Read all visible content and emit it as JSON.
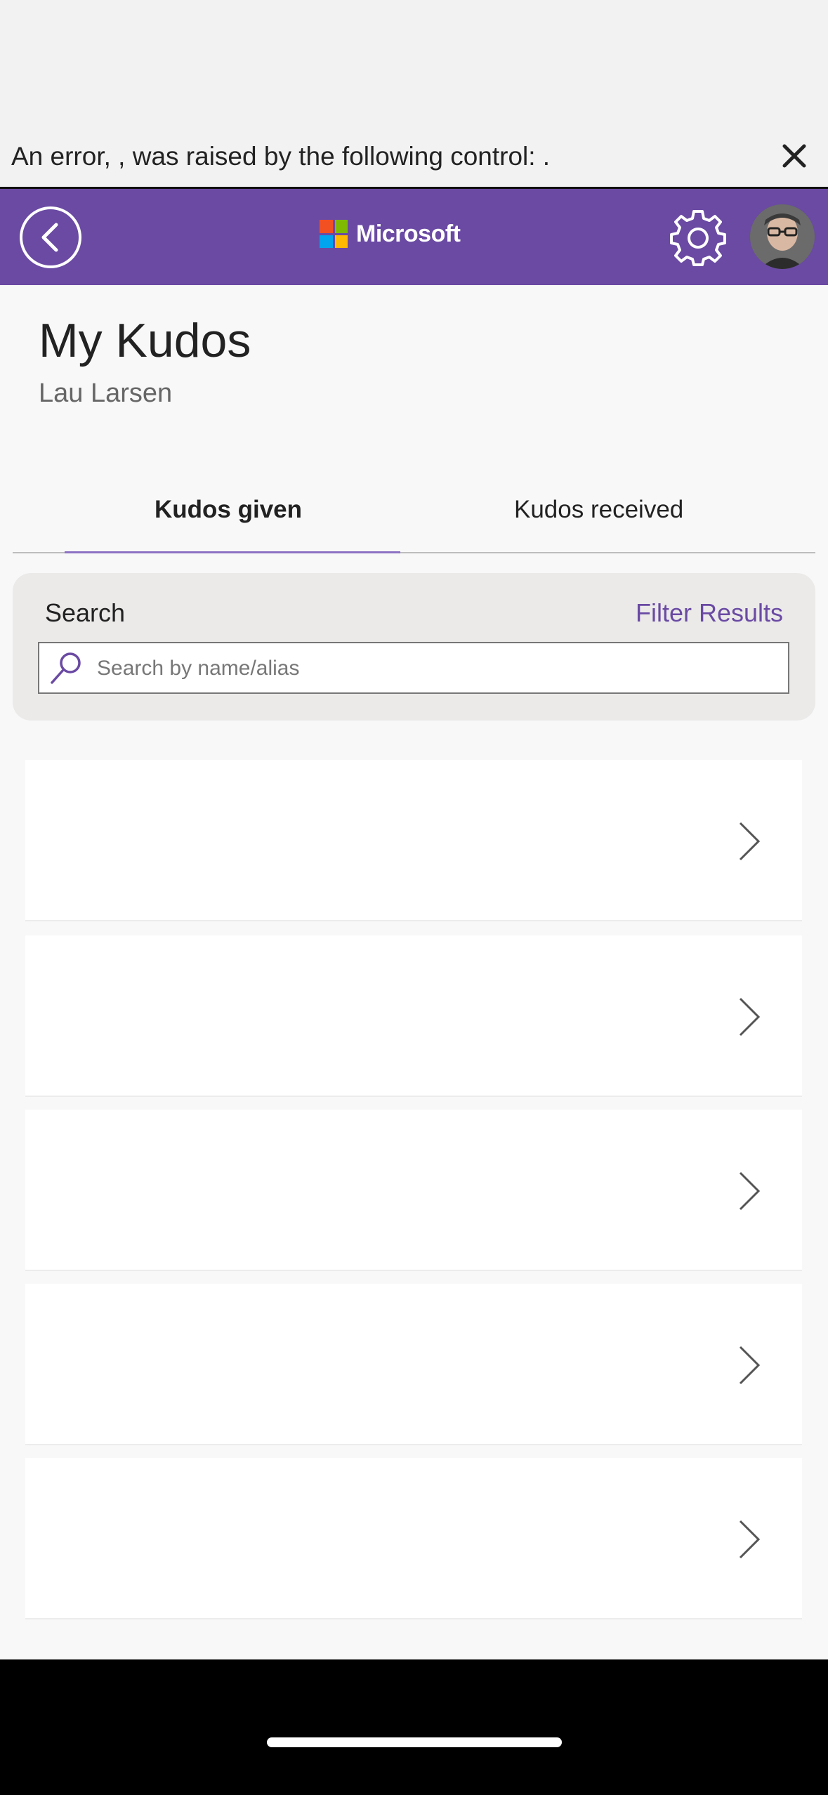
{
  "error_bar": {
    "message": "An error, , was raised by the following control: ."
  },
  "header": {
    "brand": "Microsoft",
    "logo_colors": [
      "#f25022",
      "#7fba00",
      "#00a4ef",
      "#ffb900"
    ],
    "accent_color": "#6a4aa3",
    "icons": [
      "back-icon",
      "gear-icon",
      "avatar"
    ]
  },
  "page": {
    "title": "My Kudos",
    "subtitle": "Lau Larsen"
  },
  "tabs": [
    {
      "label": "Kudos given",
      "active": true
    },
    {
      "label": "Kudos received",
      "active": false
    }
  ],
  "search": {
    "label": "Search",
    "filter_label": "Filter Results",
    "placeholder": "Search by name/alias",
    "value": ""
  },
  "list": {
    "item_count": 5,
    "icon": "chevron-right-icon"
  }
}
